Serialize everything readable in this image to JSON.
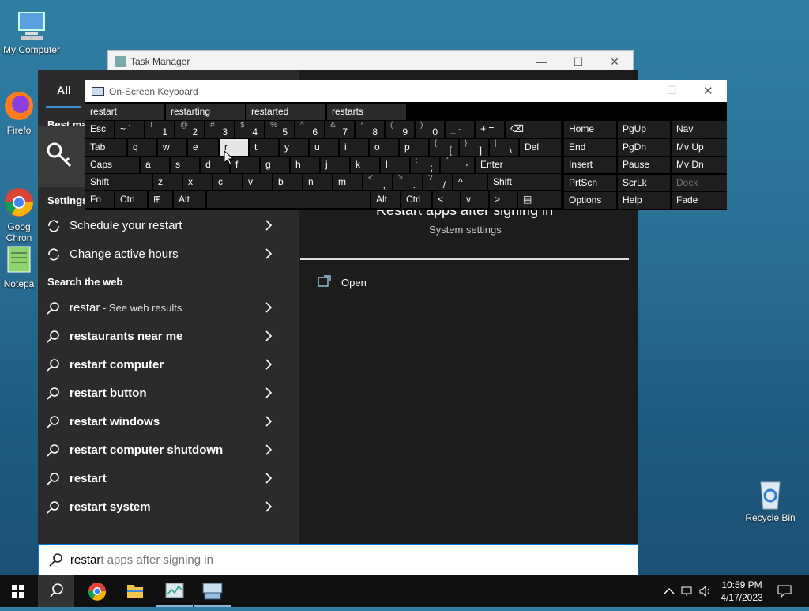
{
  "desktop": {
    "icons": [
      {
        "name": "My Computer"
      },
      {
        "name": "Firefo"
      },
      {
        "name": "Goog\nChron"
      },
      {
        "name": "Notepa"
      },
      {
        "name": "Recycle Bin"
      }
    ]
  },
  "task_manager": {
    "title": "Task Manager"
  },
  "search_panel": {
    "tab_all": "All",
    "best_match_header": "Best ma",
    "best_match_icon": "key-icon",
    "settings_header": "Settings",
    "settings_items": [
      {
        "label": "Schedule your restart"
      },
      {
        "label": "Change active hours"
      }
    ],
    "web_header": "Search the web",
    "web_items": [
      {
        "label": "restar",
        "suffix": " - See web results"
      },
      {
        "label": "restaurants near me"
      },
      {
        "label": "restart computer"
      },
      {
        "label": "restart button"
      },
      {
        "label": "restart windows"
      },
      {
        "label": "restart computer shutdown"
      },
      {
        "label": "restart"
      },
      {
        "label": "restart system"
      }
    ],
    "detail": {
      "title": "Restart apps after signing in",
      "subtitle": "System settings",
      "action": "Open"
    },
    "query_typed": "restar",
    "query_ghost": "t apps after signing in"
  },
  "osk": {
    "title": "On-Screen Keyboard",
    "suggestions": [
      "restart",
      "restarting",
      "restarted",
      "restarts"
    ],
    "row1": [
      [
        "Esc",
        ""
      ],
      [
        "~ `",
        ""
      ],
      [
        "!",
        "1"
      ],
      [
        "@",
        "2"
      ],
      [
        "#",
        "3"
      ],
      [
        "$",
        "4"
      ],
      [
        "%",
        "5"
      ],
      [
        "^",
        "6"
      ],
      [
        "&",
        "7"
      ],
      [
        "*",
        "8"
      ],
      [
        "(",
        "9"
      ],
      [
        ")",
        "0"
      ],
      [
        "_ -",
        ""
      ],
      [
        "+ =",
        ""
      ],
      [
        "⌫",
        ""
      ]
    ],
    "row2": [
      [
        "Tab",
        ""
      ],
      [
        "q",
        ""
      ],
      [
        "w",
        ""
      ],
      [
        "e",
        ""
      ],
      [
        "r",
        ""
      ],
      [
        "t",
        ""
      ],
      [
        "y",
        ""
      ],
      [
        "u",
        ""
      ],
      [
        "i",
        ""
      ],
      [
        "o",
        ""
      ],
      [
        "p",
        ""
      ],
      [
        "{",
        "["
      ],
      [
        "}",
        "]"
      ],
      [
        "|",
        "\\"
      ],
      [
        "Del",
        ""
      ]
    ],
    "row3": [
      [
        "Caps",
        ""
      ],
      [
        "a",
        ""
      ],
      [
        "s",
        ""
      ],
      [
        "d",
        ""
      ],
      [
        "f",
        ""
      ],
      [
        "g",
        ""
      ],
      [
        "h",
        ""
      ],
      [
        "j",
        ""
      ],
      [
        "k",
        ""
      ],
      [
        "l",
        ""
      ],
      [
        ":",
        ";"
      ],
      [
        "\"",
        "'"
      ],
      [
        "Enter",
        ""
      ]
    ],
    "row4": [
      [
        "Shift",
        ""
      ],
      [
        "z",
        ""
      ],
      [
        "x",
        ""
      ],
      [
        "c",
        ""
      ],
      [
        "v",
        ""
      ],
      [
        "b",
        ""
      ],
      [
        "n",
        ""
      ],
      [
        "m",
        ""
      ],
      [
        "<",
        ","
      ],
      [
        ">",
        "."
      ],
      [
        "?",
        "/"
      ],
      [
        "^",
        ""
      ],
      [
        "Shift",
        ""
      ]
    ],
    "row5": [
      [
        "Fn",
        ""
      ],
      [
        "Ctrl",
        ""
      ],
      [
        "⊞",
        ""
      ],
      [
        "Alt",
        ""
      ],
      [
        "",
        ""
      ],
      [
        "Alt",
        ""
      ],
      [
        "Ctrl",
        ""
      ],
      [
        "<",
        ""
      ],
      [
        "v",
        ""
      ],
      [
        ">",
        ""
      ],
      [
        "▤",
        ""
      ]
    ],
    "nav": [
      [
        "Home",
        "PgUp",
        "Nav"
      ],
      [
        "End",
        "PgDn",
        "Mv Up"
      ],
      [
        "Insert",
        "Pause",
        "Mv Dn"
      ],
      [
        "PrtScn",
        "ScrLk",
        "Dock"
      ],
      [
        "Options",
        "Help",
        "Fade"
      ]
    ]
  },
  "taskbar": {
    "time": "10:59 PM",
    "date": "4/17/2023"
  }
}
